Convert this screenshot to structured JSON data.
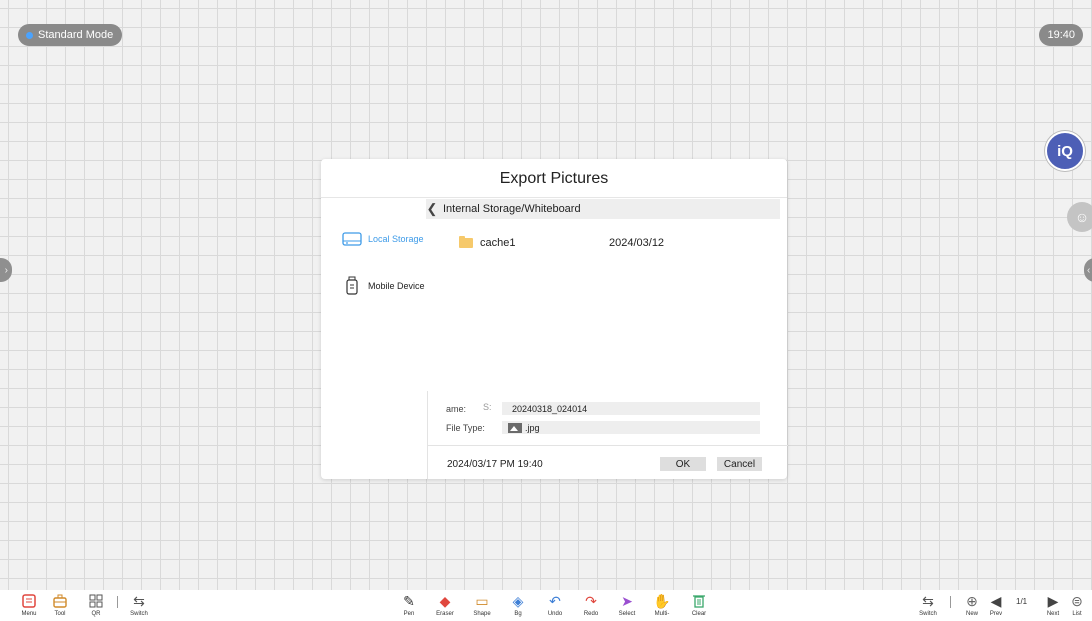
{
  "top": {
    "mode": "Standard Mode",
    "clock": "19:40",
    "iq": "iQ"
  },
  "dialog": {
    "title": "Export Pictures",
    "path": "Internal Storage/Whiteboard",
    "sidebar": [
      {
        "label": "Local Storage",
        "icon": "hard-drive-icon",
        "selected": true
      },
      {
        "label": "Mobile Device",
        "icon": "usb-drive-icon",
        "selected": false
      }
    ],
    "files": [
      {
        "name": "cache1",
        "date": "2024/03/12",
        "icon": "folder-icon"
      }
    ],
    "name_label": "ame:",
    "save_hint": "S:",
    "name_value": "20240318_024014",
    "type_label": "File Type:",
    "type_value": ".jpg",
    "datetime": "2024/03/17 PM 19:40",
    "ok": "OK",
    "cancel": "Cancel"
  },
  "toolbar": {
    "left": [
      {
        "label": "Menu",
        "icon": "menu-icon",
        "color": "#e0473e"
      },
      {
        "label": "Tool",
        "icon": "toolbox-icon",
        "color": "#d08a2a"
      },
      {
        "label": "QR",
        "icon": "qr-icon",
        "color": "#555555"
      },
      {
        "label": "Switch",
        "icon": "switch-icon",
        "color": "#555555"
      }
    ],
    "center": [
      {
        "label": "Pen",
        "icon": "pen-icon",
        "color": "#333333"
      },
      {
        "label": "Eraser",
        "icon": "eraser-icon",
        "color": "#e0473e"
      },
      {
        "label": "Shape",
        "icon": "shape-icon",
        "color": "#d08a2a"
      },
      {
        "label": "Bg",
        "icon": "fill-icon",
        "color": "#3e7fd6"
      },
      {
        "label": "Undo",
        "icon": "undo-icon",
        "color": "#3e7fd6"
      },
      {
        "label": "Redo",
        "icon": "redo-icon",
        "color": "#e0473e"
      },
      {
        "label": "Select",
        "icon": "cursor-icon",
        "color": "#9a4fd0"
      },
      {
        "label": "Multi-",
        "icon": "hand-icon",
        "color": "#e0473e"
      },
      {
        "label": "Clear",
        "icon": "trash-icon",
        "color": "#3aa86b"
      }
    ],
    "right": [
      {
        "label": "Switch",
        "icon": "switch-icon"
      },
      {
        "label": "New",
        "icon": "add-page-icon"
      },
      {
        "label": "Prev",
        "icon": "prev-page-icon"
      },
      {
        "label": "Next",
        "icon": "next-page-icon"
      },
      {
        "label": "List",
        "icon": "list-icon"
      }
    ],
    "page": "1/1"
  }
}
